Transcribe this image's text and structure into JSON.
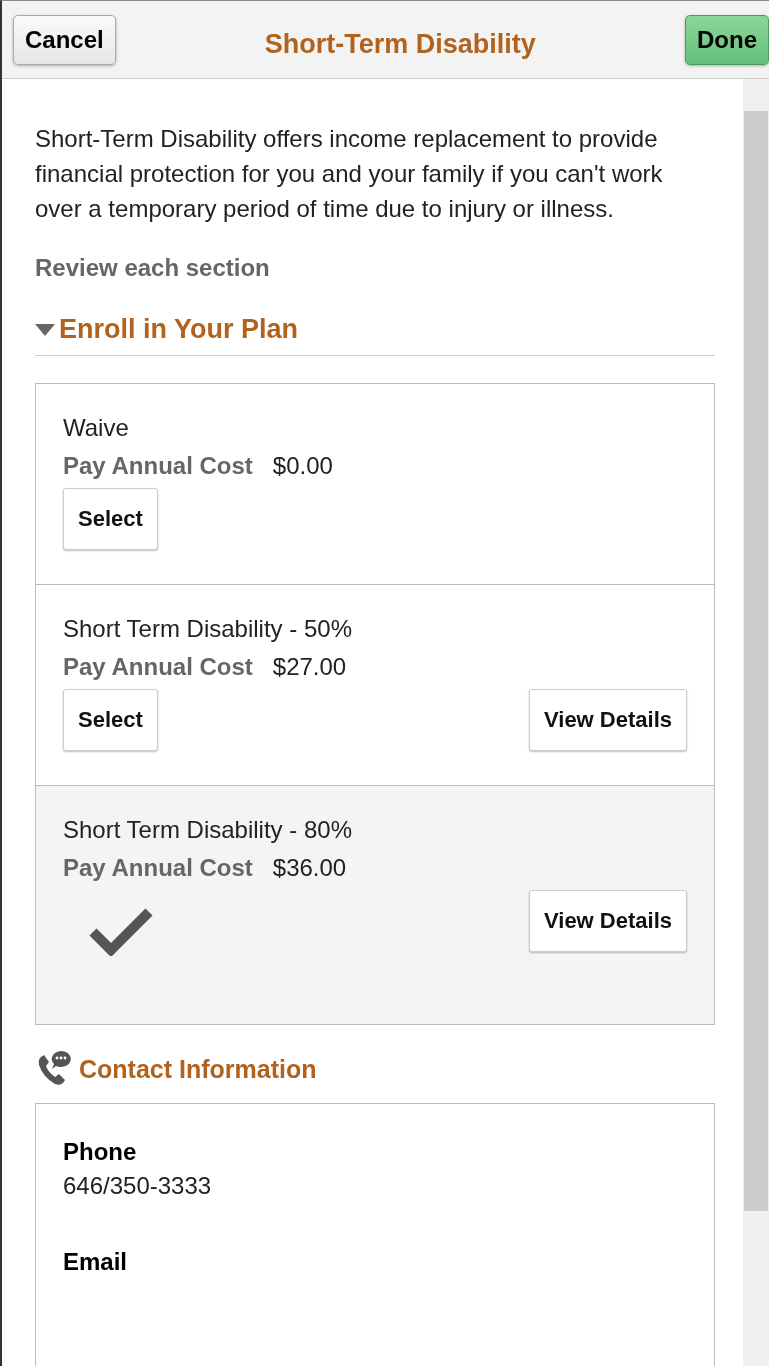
{
  "header": {
    "cancel": "Cancel",
    "title": "Short-Term Disability",
    "done": "Done"
  },
  "intro": "Short-Term Disability offers income replacement to provide financial protection for you and your family if you can't work over a temporary period of time due to injury or illness.",
  "review_label": "Review each section",
  "enroll_section": {
    "title": "Enroll in Your Plan",
    "expanded": true,
    "plans": [
      {
        "name": "Waive",
        "cost_label": "Pay Annual Cost",
        "cost": "$0.00",
        "select_button": "Select",
        "selected": false
      },
      {
        "name": "Short Term Disability - 50%",
        "cost_label": "Pay Annual Cost",
        "cost": "$27.00",
        "select_button": "Select",
        "details_button": "View Details",
        "selected": false
      },
      {
        "name": "Short Term Disability - 80%",
        "cost_label": "Pay Annual Cost",
        "cost": "$36.00",
        "details_button": "View Details",
        "selected": true
      }
    ]
  },
  "contact_section": {
    "title": "Contact Information",
    "fields": [
      {
        "label": "Phone",
        "value": "646/350-3333"
      },
      {
        "label": "Email"
      }
    ]
  }
}
